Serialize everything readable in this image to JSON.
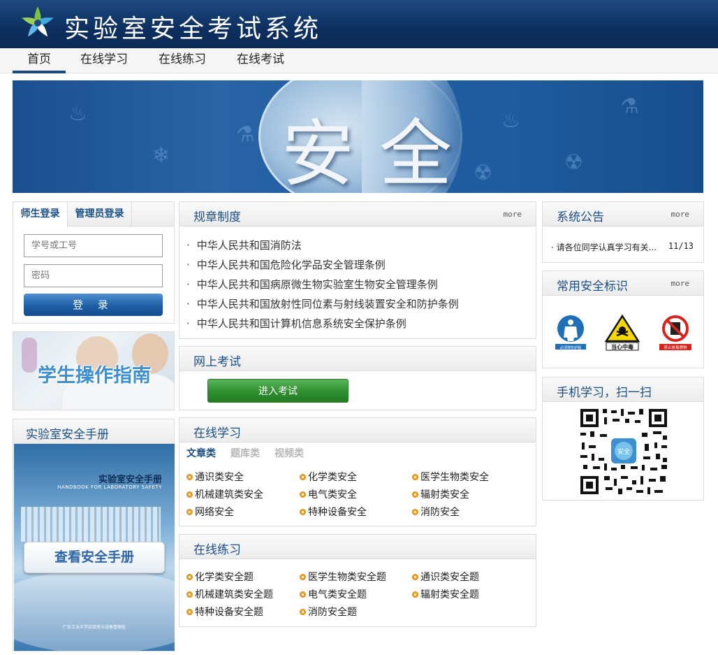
{
  "header": {
    "title": "实验室安全考试系统",
    "logo_icon": "star-logo-icon"
  },
  "nav": {
    "items": [
      "首页",
      "在线学习",
      "在线练习",
      "在线考试"
    ],
    "active": "首页"
  },
  "banner": {
    "char1": "安",
    "char2": "全"
  },
  "login": {
    "tabs": [
      "师生登录",
      "管理员登录"
    ],
    "username_placeholder": "学号或工号",
    "password_placeholder": "密码",
    "button_label": "登 录"
  },
  "guide": {
    "label": "学生操作指南"
  },
  "handbook": {
    "section_title": "实验室安全手册",
    "cover_title": "实验室安全手册",
    "cover_subtitle": "HANDBOOK FOR LABORATORY SAFETY",
    "button_label": "查看安全手册",
    "cover_footer": "广东工业大学实验室与设备管理处"
  },
  "regulations": {
    "title": "规章制度",
    "more": "more",
    "items": [
      "中华人民共和国消防法",
      "中华人民共和国危险化学品安全管理条例",
      "中华人民共和国病原微生物实验室生物安全管理条例",
      "中华人民共和国放射性同位素与射线装置安全和防护条例",
      "中华人民共和国计算机信息系统安全保护条例"
    ]
  },
  "online_exam": {
    "title": "网上考试",
    "button_label": "进入考试"
  },
  "online_study": {
    "title": "在线学习",
    "tabs": [
      "文章类",
      "题库类",
      "视频类"
    ],
    "items": [
      [
        "通识类安全",
        "化学类安全",
        "医学生物类安全"
      ],
      [
        "机械建筑类安全",
        "电气类安全",
        "辐射类安全"
      ],
      [
        "网络安全",
        "特种设备安全",
        "消防安全"
      ]
    ]
  },
  "online_practice": {
    "title": "在线练习",
    "items": [
      [
        "化学类安全题",
        "医学生物类安全题",
        "通识类安全题"
      ],
      [
        "机械建筑类安全题",
        "电气类安全题",
        "辐射类安全题"
      ],
      [
        "特种设备安全题",
        "消防安全题",
        ""
      ]
    ]
  },
  "notices": {
    "title": "系统公告",
    "more": "more",
    "item_text": "请各位同学认真学习有关...",
    "item_date": "11/13"
  },
  "safety_signs": {
    "title": "常用安全标识",
    "more": "more",
    "signs": [
      {
        "icon": "protective-suit-sign-icon",
        "label": "必须穿防护服"
      },
      {
        "icon": "poison-warning-sign-icon",
        "label": "当心中毒"
      },
      {
        "icon": "no-flammables-sign-icon",
        "label": "禁止放易燃物"
      }
    ]
  },
  "mobile": {
    "title": "手机学习，扫一扫",
    "qr_center": "安全"
  },
  "colors": {
    "header_bg": "#0c2f5f",
    "accent": "#1a4f86",
    "exam_button": "#2f8f2f",
    "bullet": "#f0a020"
  }
}
